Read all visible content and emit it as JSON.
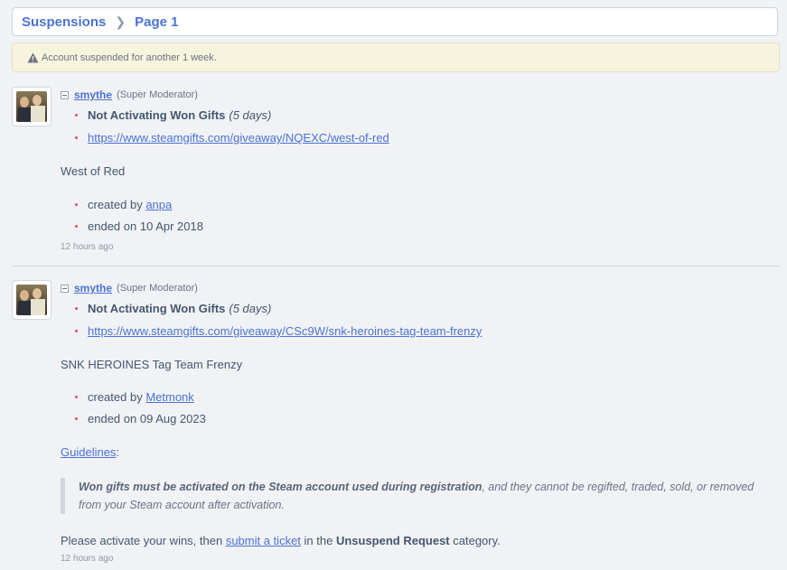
{
  "breadcrumb": {
    "section": "Suspensions",
    "page": "Page 1"
  },
  "notice": {
    "text": "Account suspended for another 1 week."
  },
  "comments": [
    {
      "user": "smythe",
      "role": "(Super Moderator)",
      "reason": "Not Activating Won Gifts",
      "duration": "(5 days)",
      "url": "https://www.steamgifts.com/giveaway/NQEXC/west-of-red",
      "game": "West of Red",
      "created_prefix": "created by",
      "creator": "anpa",
      "ended": "ended on 10 Apr 2018",
      "time": "12 hours ago"
    },
    {
      "user": "smythe",
      "role": "(Super Moderator)",
      "reason": "Not Activating Won Gifts",
      "duration": "(5 days)",
      "url": "https://www.steamgifts.com/giveaway/CSc9W/snk-heroines-tag-team-frenzy",
      "game": "SNK HEROINES Tag Team Frenzy",
      "created_prefix": "created by",
      "creator": "Metmonk",
      "ended": "ended on 09 Aug 2023",
      "guidelines_label": "Guidelines",
      "guidelines_colon": ":",
      "quote_bold": "Won gifts must be activated on the Steam account used during registration",
      "quote_rest": ", and they cannot be regifted, traded, sold, or removed from your Steam account after activation.",
      "please_prefix": "Please activate your wins, then ",
      "ticket_link": "submit a ticket",
      "please_mid": " in the ",
      "category": "Unsuspend Request",
      "please_suffix": " category.",
      "time": "12 hours ago"
    }
  ],
  "icons": {
    "warning": "warning-icon",
    "chevron": "chevron-right-icon",
    "collapse": "collapse-icon"
  }
}
